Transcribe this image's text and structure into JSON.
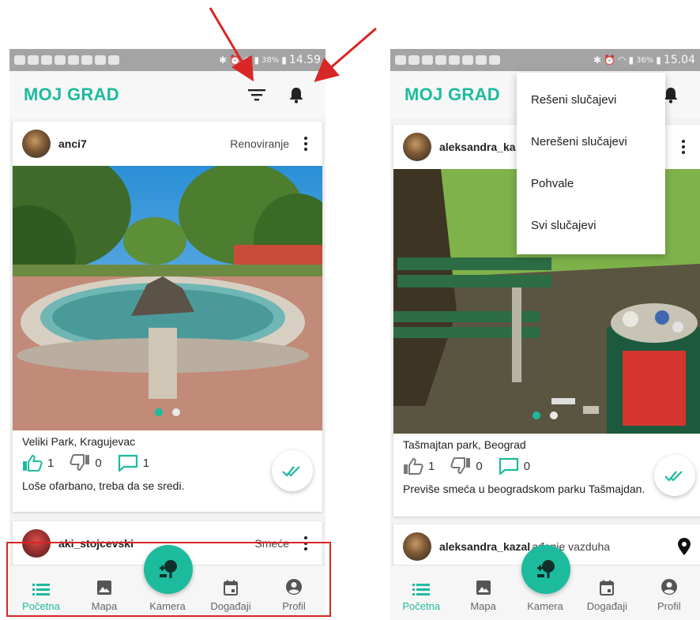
{
  "colors": {
    "accent": "#1dbb9e",
    "annotation": "#d92626"
  },
  "left": {
    "status": {
      "battery": "38%",
      "time": "14.59"
    },
    "brand": "MOJ GRAD",
    "post": {
      "username": "anci7",
      "category": "Renoviranje",
      "caption": "Veliki Park, Kragujevac",
      "likes": "1",
      "dislikes": "0",
      "comments": "1",
      "description": "Loše ofarbano, treba da se sredi."
    },
    "next_post": {
      "username": "aki_stojcevski",
      "category": "Smeće"
    }
  },
  "right": {
    "status": {
      "battery": "36%",
      "time": "15.04"
    },
    "brand": "MOJ GRAD",
    "post": {
      "username": "aleksandra_ka",
      "caption": "Tašmajtan park, Beograd",
      "likes": "1",
      "dislikes": "0",
      "comments": "0",
      "description": "Previše smeća u beogradskom parku Tašmajdan."
    },
    "next_post": {
      "username": "aleksandra_kazal",
      "category": "ađenje vazduha"
    },
    "menu": [
      "Rešeni slučajevi",
      "Nerešeni slučajevi",
      "Pohvale",
      "Svi slučajevi"
    ]
  },
  "nav": {
    "home": "Početna",
    "map": "Mapa",
    "camera": "Kamera",
    "events": "Događaji",
    "profile": "Profil"
  }
}
